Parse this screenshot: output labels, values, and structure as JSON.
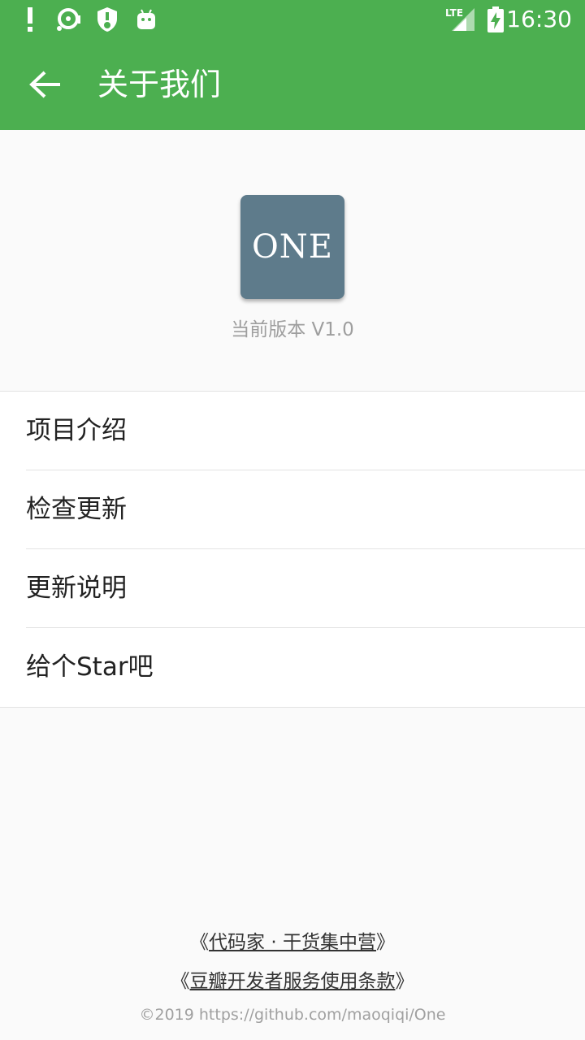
{
  "status_bar": {
    "time": "16:30",
    "network": "LTE",
    "icons": [
      "alert-icon",
      "sync-icon",
      "shield-icon",
      "android-icon",
      "signal-icon",
      "battery-charging-icon"
    ]
  },
  "toolbar": {
    "back_icon": "arrow-left-icon",
    "title": "关于我们"
  },
  "header": {
    "logo_text": "ONE",
    "version": "当前版本 V1.0"
  },
  "menu": {
    "items": [
      {
        "label": "项目介绍"
      },
      {
        "label": "检查更新"
      },
      {
        "label": "更新说明"
      },
      {
        "label": "给个Star吧"
      }
    ]
  },
  "footer": {
    "link1": {
      "open": "《",
      "text": "代码家 · 干货集中营",
      "close": "》"
    },
    "link2": {
      "open": "《",
      "text": "豆瓣开发者服务使用条款",
      "close": "》"
    },
    "copyright": "©2019 https://github.com/maoqiqi/One"
  },
  "colors": {
    "primary": "#4caf50",
    "logo_bg": "#5e7b8b",
    "background": "#fafafa"
  }
}
